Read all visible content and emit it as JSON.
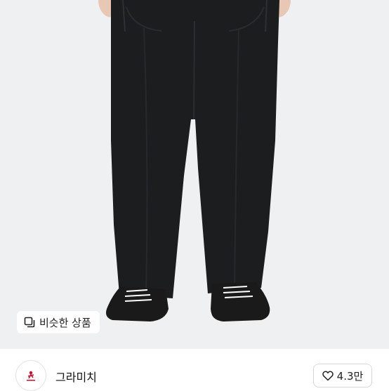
{
  "product": {
    "image_alt": "black corduroy pants with sneakers",
    "similar_products_label": "비슷한 상품"
  },
  "brand": {
    "name": "그라미치",
    "logo_icon": "gramicci-logo-icon"
  },
  "like": {
    "icon": "heart-outline-icon",
    "count": "4.3만"
  },
  "colors": {
    "photo_background": "#eef0f2",
    "pants": "#1c1d1f",
    "logo_accent": "#c8102e"
  }
}
